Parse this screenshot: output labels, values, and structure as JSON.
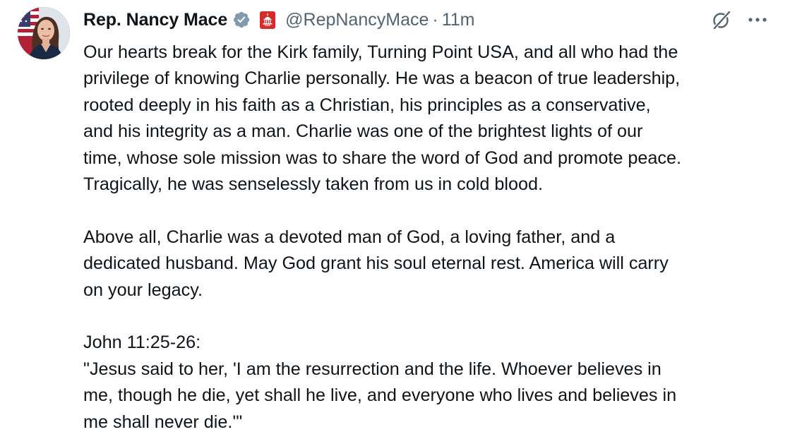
{
  "colors": {
    "text_primary": "#0f1419",
    "text_secondary": "#536471",
    "verified_badge": "#829aab",
    "affiliation_badge": "#d52b2b"
  },
  "author": {
    "avatar_icon": "profile-photo",
    "display_name": "Rep. Nancy Mace",
    "verified_icon": "gray-verified-badge-icon",
    "affiliation_icon": "us-capitol-badge-icon",
    "handle": "@RepNancyMace",
    "separator": "·",
    "timestamp": "11m"
  },
  "actions": {
    "grok_icon": "grok-icon",
    "more_icon": "more-horizontal-icon"
  },
  "post": {
    "paragraphs": [
      {
        "lines": [
          "Our hearts break for the Kirk family, Turning Point USA, and all who had the",
          "privilege of knowing Charlie personally. He was a beacon of true leadership,",
          "rooted deeply in his faith as a Christian, his principles as a conservative,",
          "and his integrity as a man. Charlie was one of the brightest lights of our",
          "time, whose sole mission was to share the word of God and promote peace.",
          "Tragically, he was senselessly taken from us in cold blood."
        ]
      },
      {
        "lines": [
          "Above all, Charlie was a devoted man of God, a loving father, and a",
          "dedicated husband. May God grant his soul eternal rest. America will carry",
          "on your legacy."
        ]
      },
      {
        "lines": [
          "John 11:25-26:",
          "\"Jesus said to her, 'I am the resurrection and the life. Whoever believes in",
          "me, though he die, yet shall he live, and everyone who lives and believes in",
          "me shall never die.'\""
        ]
      }
    ]
  }
}
